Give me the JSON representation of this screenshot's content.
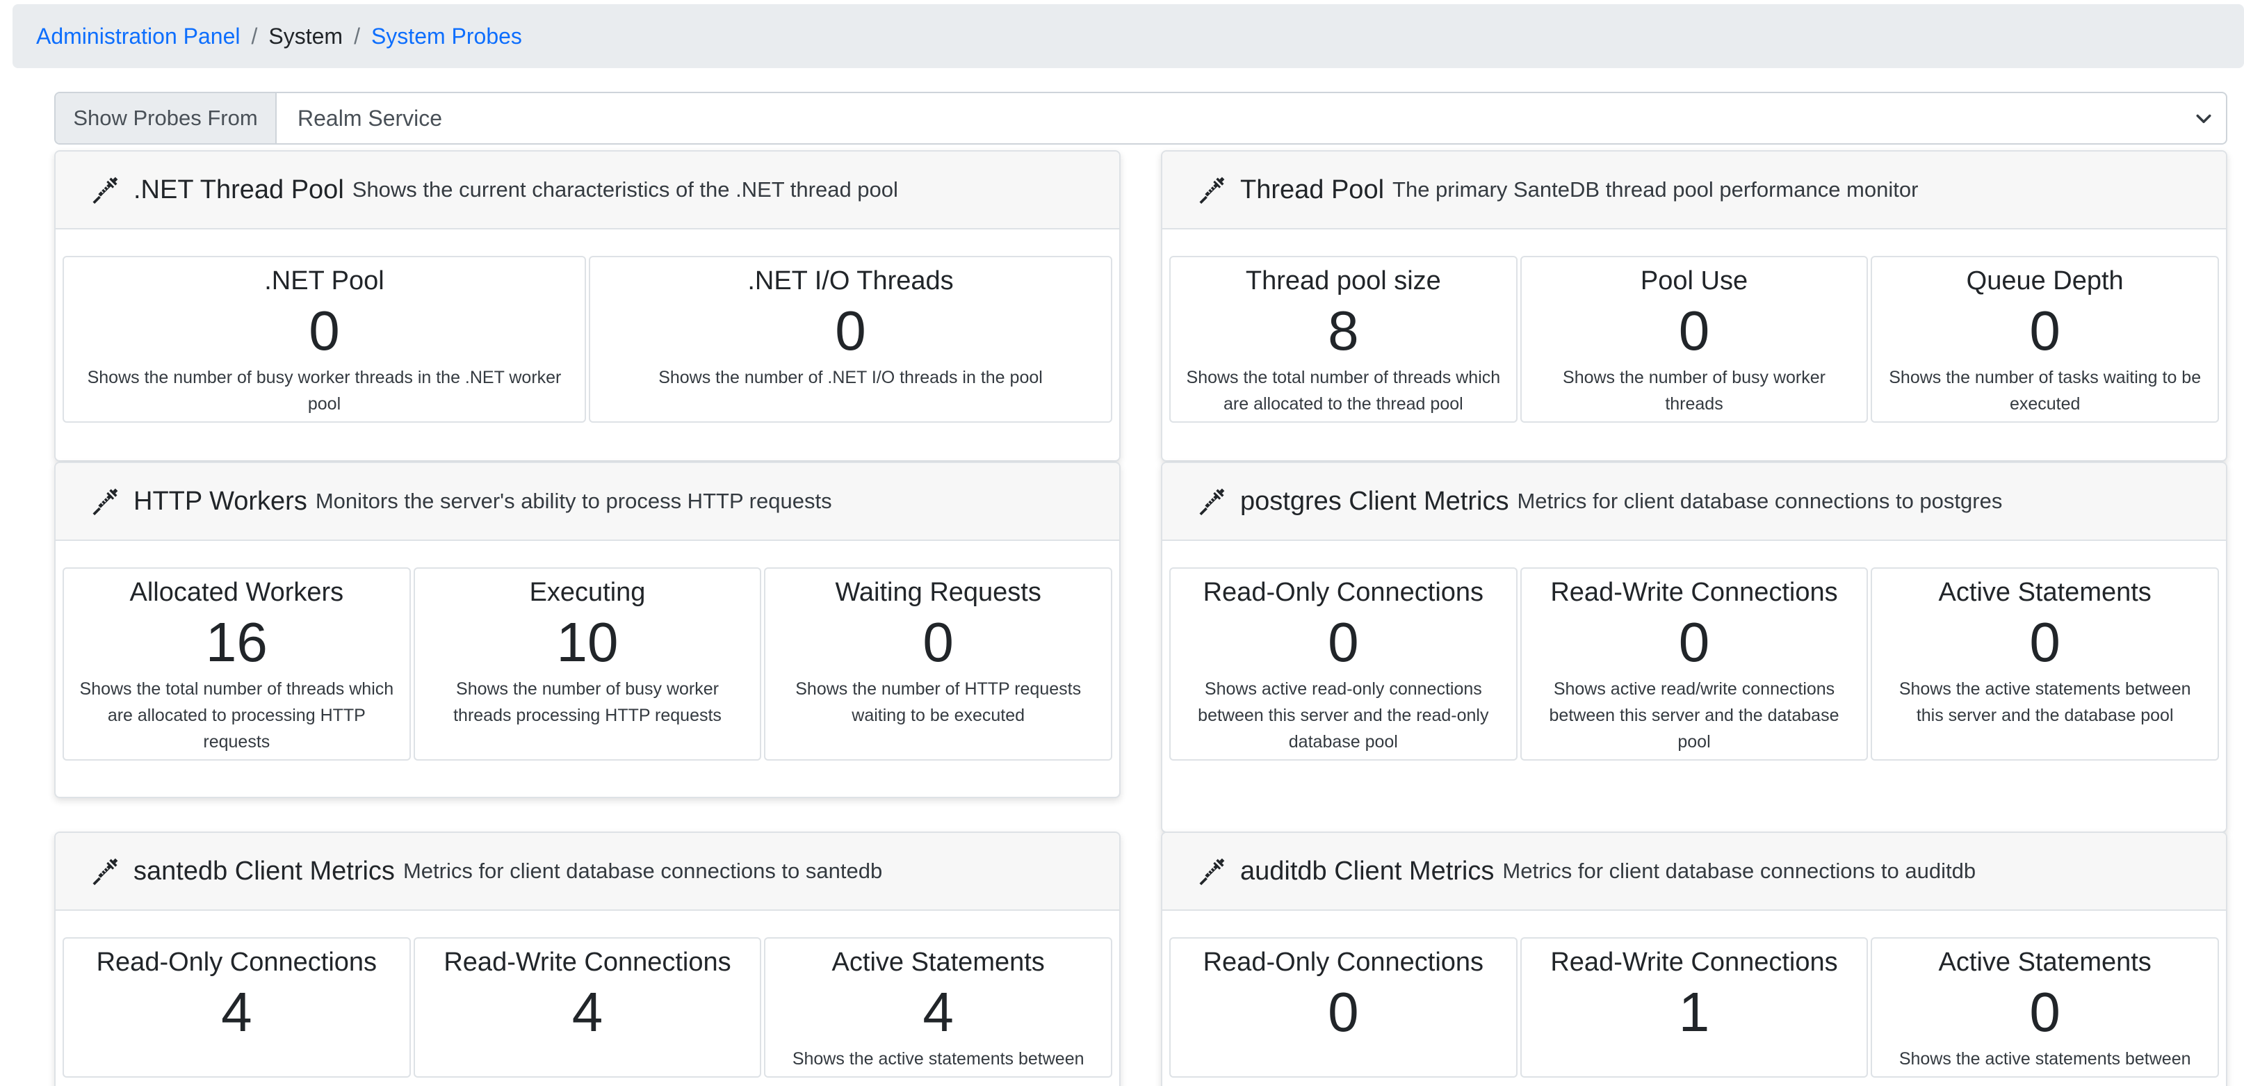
{
  "breadcrumb": {
    "root": "Administration Panel",
    "separator": "/",
    "section": "System",
    "current": "System Probes"
  },
  "selector": {
    "label": "Show Probes From",
    "value": "Realm Service"
  },
  "cards": {
    "net": {
      "title": ".NET Thread Pool",
      "description": "Shows the current characteristics of the .NET thread pool",
      "metrics": [
        {
          "title": ".NET Pool",
          "value": "0",
          "description": "Shows the number of busy worker threads in the .NET worker pool"
        },
        {
          "title": ".NET I/O Threads",
          "value": "0",
          "description": "Shows the number of .NET I/O threads in the pool"
        }
      ]
    },
    "thread": {
      "title": "Thread Pool",
      "description": "The primary SanteDB thread pool performance monitor",
      "metrics": [
        {
          "title": "Thread pool size",
          "value": "8",
          "description": "Shows the total number of threads which are allocated to the thread pool"
        },
        {
          "title": "Pool Use",
          "value": "0",
          "description": "Shows the number of busy worker threads"
        },
        {
          "title": "Queue Depth",
          "value": "0",
          "description": "Shows the number of tasks waiting to be executed"
        }
      ]
    },
    "http": {
      "title": "HTTP Workers",
      "description": "Monitors the server's ability to process HTTP requests",
      "metrics": [
        {
          "title": "Allocated Workers",
          "value": "16",
          "description": "Shows the total number of threads which are allocated to processing HTTP requests"
        },
        {
          "title": "Executing",
          "value": "10",
          "description": "Shows the number of busy worker threads processing HTTP requests"
        },
        {
          "title": "Waiting Requests",
          "value": "0",
          "description": "Shows the number of HTTP requests waiting to be executed"
        }
      ]
    },
    "pg": {
      "title": "postgres Client Metrics",
      "description": "Metrics for client database connections to postgres",
      "metrics": [
        {
          "title": "Read-Only Connections",
          "value": "0",
          "description": "Shows active read-only connections between this server and the read-only database pool"
        },
        {
          "title": "Read-Write Connections",
          "value": "0",
          "description": "Shows active read/write connections between this server and the database pool"
        },
        {
          "title": "Active Statements",
          "value": "0",
          "description": "Shows the active statements between this server and the database pool"
        }
      ]
    },
    "santedb": {
      "title": "santedb Client Metrics",
      "description": "Metrics for client database connections to santedb",
      "metrics": [
        {
          "title": "Read-Only Connections",
          "value": "4",
          "description": ""
        },
        {
          "title": "Read-Write Connections",
          "value": "4",
          "description": ""
        },
        {
          "title": "Active Statements",
          "value": "4",
          "description": "Shows the active statements between"
        }
      ]
    },
    "auditdb": {
      "title": "auditdb Client Metrics",
      "description": "Metrics for client database connections to auditdb",
      "metrics": [
        {
          "title": "Read-Only Connections",
          "value": "0",
          "description": ""
        },
        {
          "title": "Read-Write Connections",
          "value": "1",
          "description": ""
        },
        {
          "title": "Active Statements",
          "value": "0",
          "description": "Shows the active statements between"
        }
      ]
    }
  },
  "colors": {
    "link": "#0d6efd",
    "breadcrumb_bg": "#e9ecef",
    "card_header_bg": "#f7f7f7",
    "border": "#dee2e6"
  },
  "icons": {
    "probe": "syringe-icon",
    "dropdown": "chevron-down-icon"
  }
}
